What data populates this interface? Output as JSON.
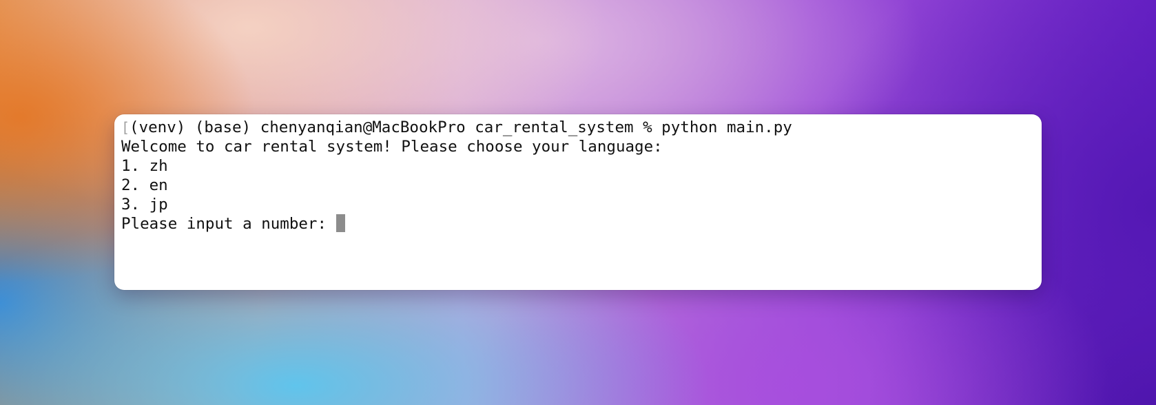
{
  "terminal": {
    "lines": [
      {
        "mark": "[",
        "text": "(venv) (base) chenyanqian@MacBookPro car_rental_system % python main.py"
      },
      {
        "text": "Welcome to car rental system! Please choose your language:"
      },
      {
        "text": "1. zh"
      },
      {
        "text": "2. en"
      },
      {
        "text": "3. jp"
      },
      {
        "text": "Please input a number: "
      }
    ]
  }
}
